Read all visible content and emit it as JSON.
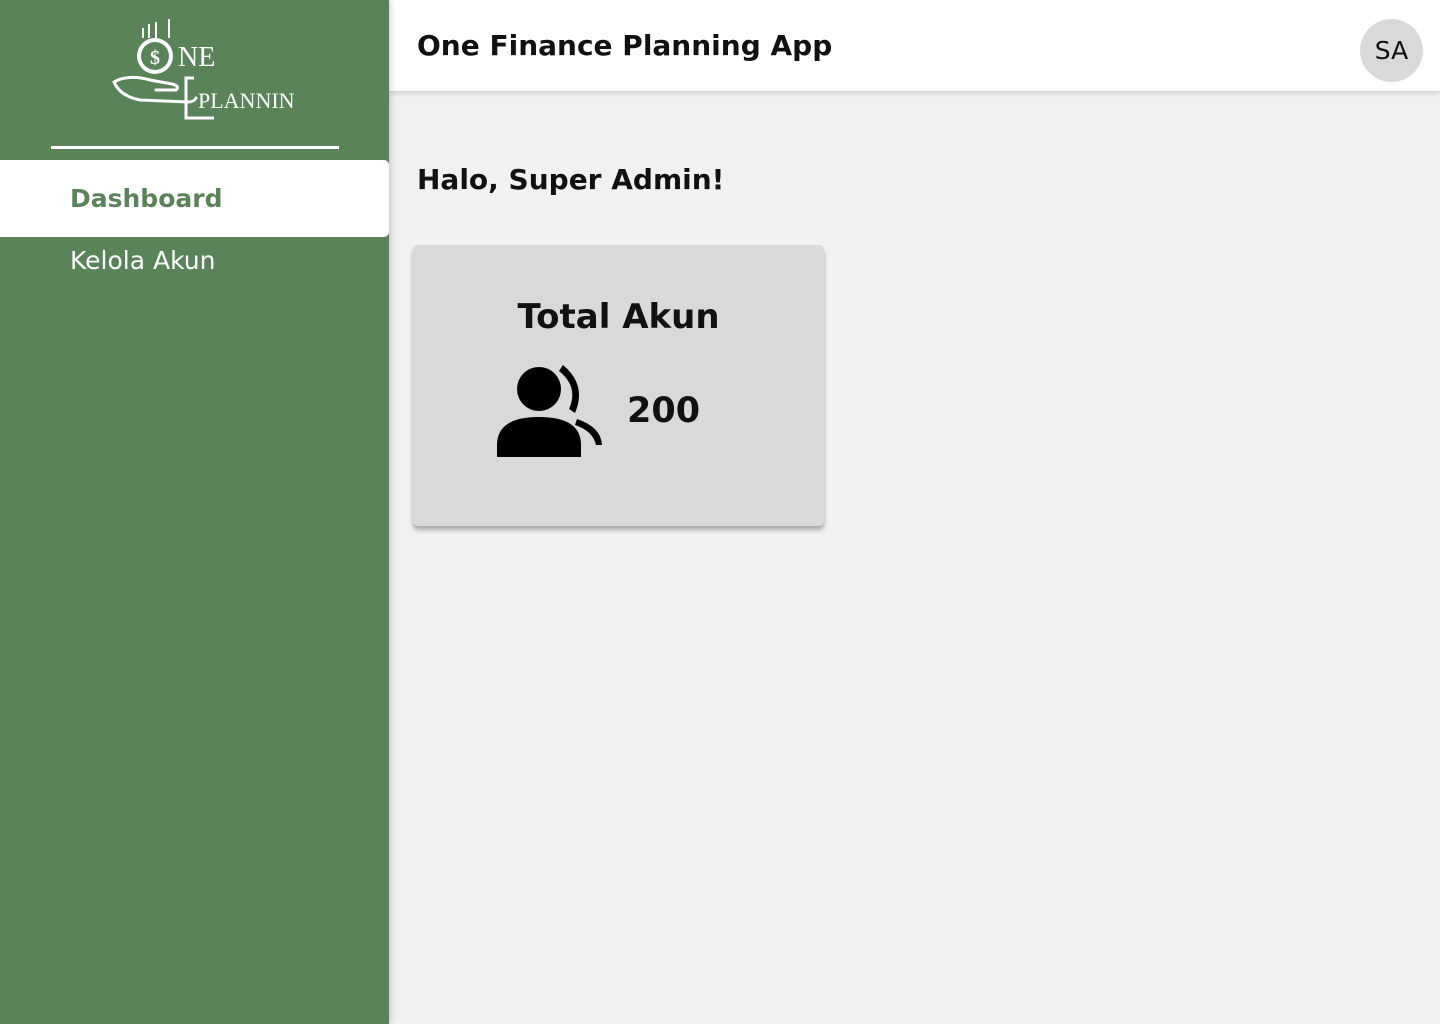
{
  "app": {
    "logo_text_top": "NE",
    "logo_text_bottom": "PLANNING",
    "title": "One Finance Planning App"
  },
  "sidebar": {
    "items": [
      {
        "label": "Dashboard",
        "active": true
      },
      {
        "label": "Kelola Akun",
        "active": false
      }
    ]
  },
  "user": {
    "initials": "SA"
  },
  "main": {
    "greeting": "Halo, Super Admin!",
    "stat_card": {
      "title": "Total Akun",
      "value": "200",
      "icon": "users-icon"
    }
  },
  "colors": {
    "brand_green": "#5a8359",
    "background": "#f1f1f1",
    "card": "#d9d9d9",
    "avatar": "#d9d9d9"
  }
}
